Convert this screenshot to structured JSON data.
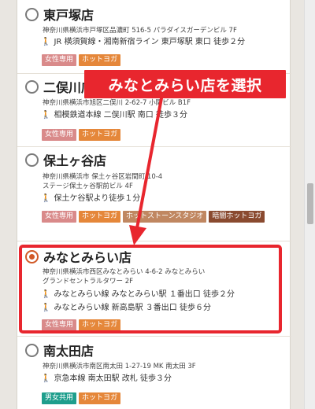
{
  "stores": [
    {
      "name": "東戸塚店",
      "address_lines": [
        "神奈川県横浜市戸塚区品濃町 516-5 パラダイスガーデンビル 7F"
      ],
      "access": [
        "JR 横須賀線・湘南新宿ライン 東戸塚駅 東口 徒歩２分"
      ],
      "tags": [
        "女性専用",
        "ホットヨガ"
      ],
      "selected": false
    },
    {
      "name": "二俣川店",
      "address_lines": [
        "神奈川県横浜市旭区二俣川 2-62-7 小関ビル B1F"
      ],
      "access": [
        "相模鉄道本線 二俣川駅 南口 徒歩３分"
      ],
      "tags": [
        "女性専用",
        "ホットヨガ"
      ],
      "selected": false
    },
    {
      "name": "保土ヶ谷店",
      "address_lines": [
        "神奈川県横浜市 保土ヶ谷区岩間町 10-4",
        "ステージ保土ヶ谷駅前ビル 4F"
      ],
      "access": [
        "保土ケ谷駅より徒歩１分"
      ],
      "tags": [
        "女性専用",
        "ホットヨガ",
        "ホットストーンスタジオ",
        "暗闇ホットヨガ"
      ],
      "selected": false
    },
    {
      "name": "みなとみらい店",
      "address_lines": [
        "神奈川県横浜市西区みなとみらい 4-6-2 みなとみらい",
        "グランドセントラルタワー 2F"
      ],
      "access": [
        "みなとみらい線 みなとみらい駅 １番出口 徒歩２分",
        "みなとみらい線 新高島駅 ３番出口 徒歩６分"
      ],
      "tags": [
        "女性専用",
        "ホットヨガ"
      ],
      "selected": true
    },
    {
      "name": "南太田店",
      "address_lines": [
        "神奈川県横浜市南区南太田 1-27-19 MK 南太田 3F"
      ],
      "access": [
        "京急本線 南太田駅 改札 徒歩３分"
      ],
      "tags": [
        "男女共用",
        "ホットヨガ"
      ],
      "selected": false
    }
  ],
  "annotation": {
    "callout_text": "みなとみらい店を選択",
    "color": "#e8262e"
  },
  "colors": {
    "radio_selected": "#d15a28",
    "tag_women": "#d98a8a",
    "tag_hot_yoga": "#e5873a",
    "tag_hot_stone": "#c08761",
    "tag_dark_yoga": "#8a4a2f",
    "tag_unisex": "#1e9e8c"
  },
  "icons": {
    "access": "walking-person-icon",
    "radio_unchecked": "radio-unchecked-icon",
    "radio_checked": "radio-checked-icon"
  }
}
